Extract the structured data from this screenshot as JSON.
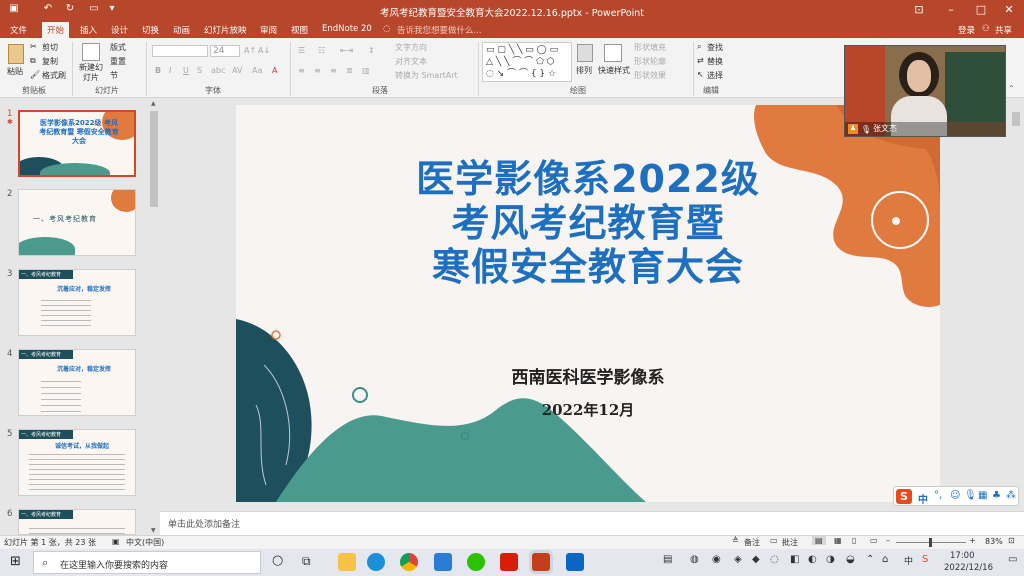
{
  "titlebar": {
    "title": "考风考纪教育暨安全教育大会2022.12.16.pptx - PowerPoint"
  },
  "tabs": {
    "file": "文件",
    "home": "开始",
    "insert": "插入",
    "design": "设计",
    "transitions": "切换",
    "animations": "动画",
    "slideshow": "幻灯片放映",
    "review": "审阅",
    "view": "视图",
    "endnote": "EndNote 20",
    "tellme": "告诉我您想要做什么...",
    "login": "登录",
    "share": "共享"
  },
  "ribbon": {
    "paste": "粘贴",
    "cut": "剪切",
    "copy": "复制",
    "painter": "格式刷",
    "clipboard": "剪贴板",
    "new_slide": "新建幻灯片",
    "layout": "版式",
    "reset": "重置",
    "section": "节",
    "slides": "幻灯片",
    "font_size": "24",
    "font": "字体",
    "text_dir": "文字方向",
    "align_text": "对齐文本",
    "smartart": "转换为 SmartArt",
    "paragraph": "段落",
    "arrange": "排列",
    "quick_styles": "快速样式",
    "fill": "形状填充",
    "outline": "形状轮廓",
    "effects": "形状效果",
    "drawing": "绘图",
    "find": "查找",
    "replace": "替换",
    "select": "选择",
    "editing": "编辑"
  },
  "thumbnails": [
    {
      "num": "1",
      "title": "医学影像系2022级 考风考纪教育暨 寒假安全教育大会"
    },
    {
      "num": "2",
      "title": "一、考风考纪教育"
    },
    {
      "num": "3",
      "title": "一、考风考纪教育",
      "sub": "沉着应对，稳定发挥"
    },
    {
      "num": "4",
      "title": "一、考风考纪教育",
      "sub": "沉着应对，稳定发挥"
    },
    {
      "num": "5",
      "title": "一、考风考纪教育",
      "sub": "诚信考试，从我做起"
    },
    {
      "num": "6",
      "title": "一、考风考纪教育"
    }
  ],
  "slide": {
    "line1": "医学影像系2022级",
    "line2": "考风考纪教育暨",
    "line3": "寒假安全教育大会",
    "subtitle": "西南医科医学影像系",
    "date": "2022年12月"
  },
  "notes": {
    "placeholder": "单击此处添加备注"
  },
  "status": {
    "slide_info": "幻灯片 第 1 张，共 23 张",
    "language": "中文(中国)",
    "notes_btn": "备注",
    "comments_btn": "批注",
    "zoom": "83%"
  },
  "taskbar": {
    "search_placeholder": "在这里输入你要搜索的内容",
    "time": "17:00",
    "date": "2022/12/16",
    "ime": "中"
  },
  "camera": {
    "name": "张文杰"
  },
  "sogou": {
    "label": "中"
  },
  "colors": {
    "accent": "#b7472a",
    "title_blue": "#1f6fc0",
    "teal": "#4a9a8e",
    "dark_teal": "#1d4f5c",
    "orange": "#e07a3f"
  }
}
